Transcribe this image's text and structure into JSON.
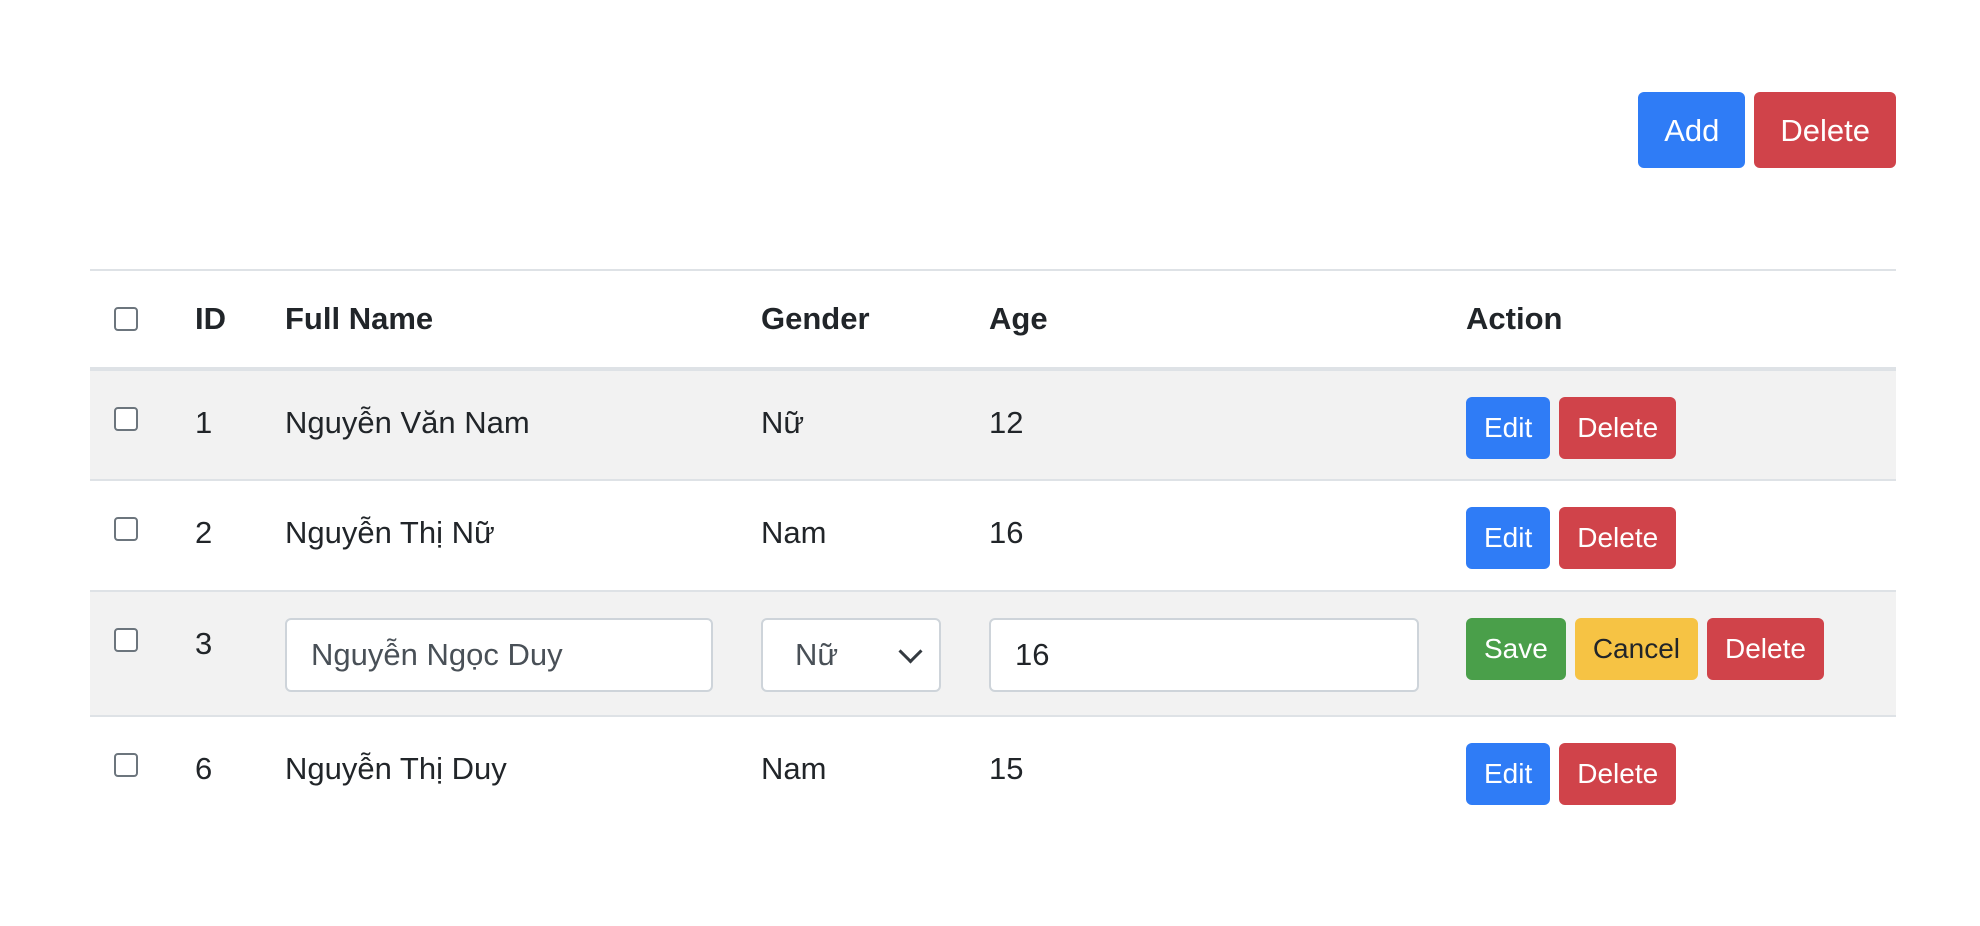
{
  "toolbar": {
    "add_label": "Add",
    "delete_label": "Delete"
  },
  "table": {
    "headers": {
      "id": "ID",
      "full_name": "Full Name",
      "gender": "Gender",
      "age": "Age",
      "action": "Action"
    },
    "rows": [
      {
        "id": "1",
        "full_name": "Nguyễn Văn Nam",
        "gender": "Nữ",
        "age": "12",
        "edit_label": "Edit",
        "delete_label": "Delete"
      },
      {
        "id": "2",
        "full_name": "Nguyễn Thị Nữ",
        "gender": "Nam",
        "age": "16",
        "edit_label": "Edit",
        "delete_label": "Delete"
      },
      {
        "id": "3",
        "full_name": "Nguyễn Ngọc Duy",
        "gender": "Nữ",
        "age": "16",
        "save_label": "Save",
        "cancel_label": "Cancel",
        "delete_label": "Delete"
      },
      {
        "id": "6",
        "full_name": "Nguyễn Thị Duy",
        "gender": "Nam",
        "age": "15",
        "edit_label": "Edit",
        "delete_label": "Delete"
      }
    ]
  },
  "colors": {
    "primary": "#2f7cf6",
    "danger": "#d0434a",
    "success": "#4a9f4a",
    "warning": "#f6c344",
    "row_stripe": "#f2f2f2"
  },
  "icons": {
    "select_arrow": "chevron-down-icon"
  }
}
